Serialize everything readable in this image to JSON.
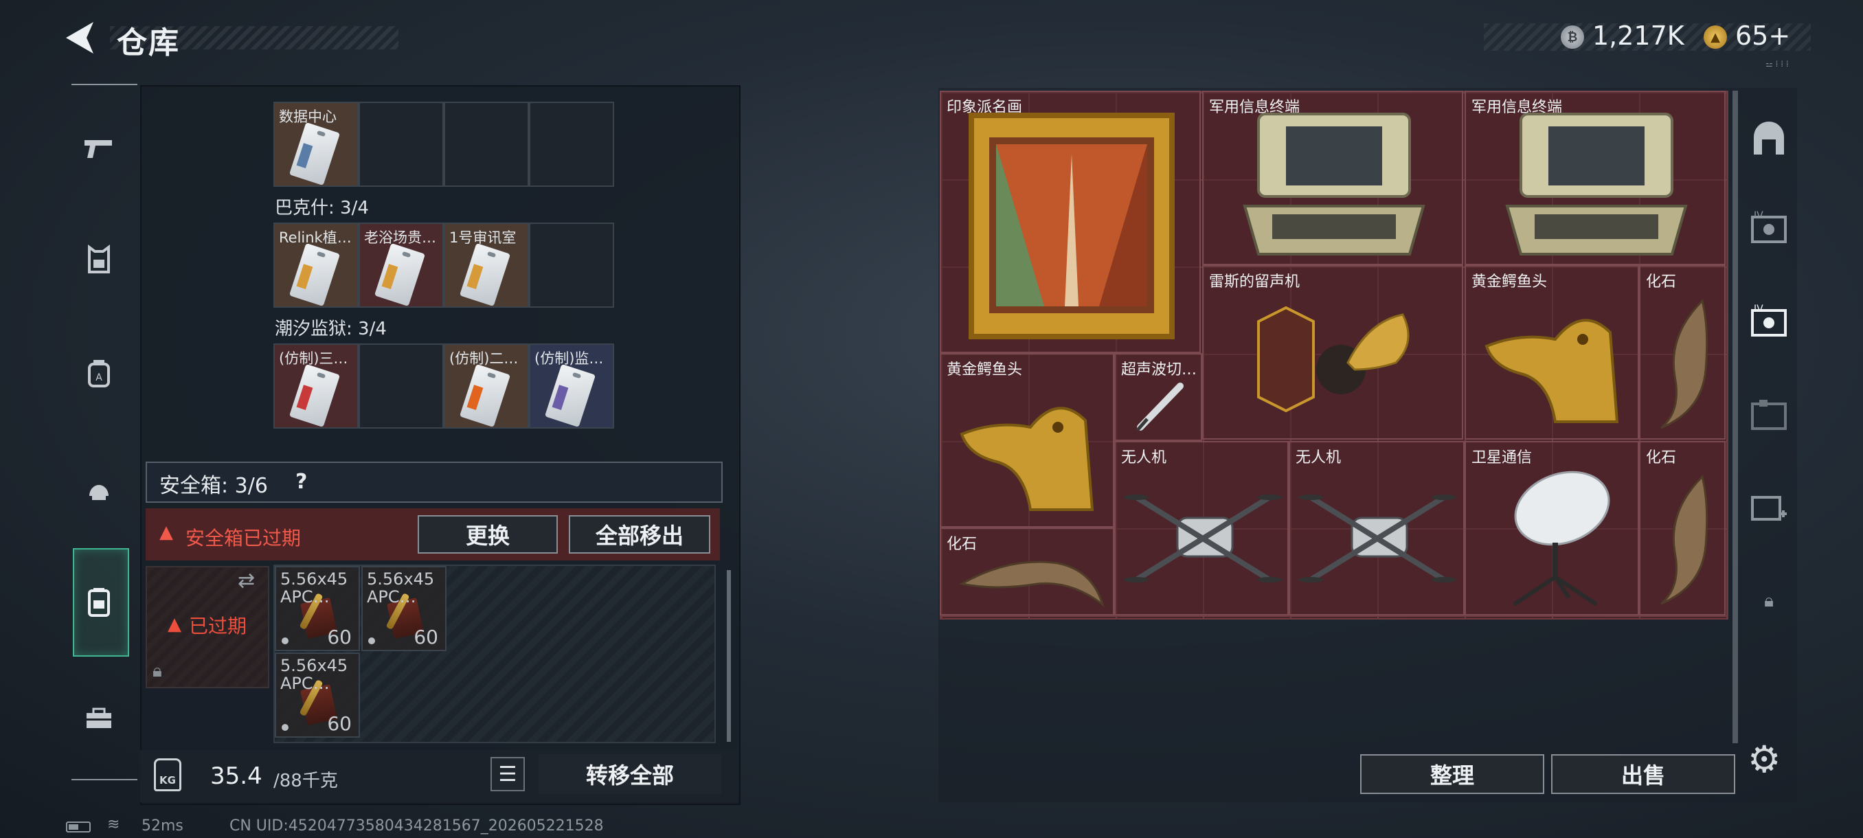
{
  "header": {
    "title": "仓库",
    "currency_silver": "1,217K",
    "currency_gold": "65+",
    "small_text": "⚍ ⁞ ⁞ ⁞"
  },
  "left": {
    "prev_label": "数据中心",
    "sections": [
      {
        "title": "巴克什: 3/4",
        "cells": [
          "Relink植…",
          "老浴场贵…",
          "1号审讯室",
          ""
        ]
      },
      {
        "title": "潮汐监狱: 3/4",
        "cells": [
          "(仿制)三…",
          "",
          "(仿制)二…",
          "(仿制)监…"
        ]
      }
    ],
    "safebox_label": "安全箱: 3/6",
    "safebox_help": "?",
    "expired_warning": "安全箱已过期",
    "btn_replace": "更换",
    "btn_move_all": "全部移出",
    "thumb_expired": "已过期",
    "ammo": [
      {
        "name": "5.56x45 APC…",
        "count": "60"
      },
      {
        "name": "5.56x45 APC…",
        "count": "60"
      },
      {
        "name": "5.56x45 APC…",
        "count": "60"
      }
    ],
    "weight_current": "35.4",
    "weight_max": "/88千克",
    "kg_label": "KG",
    "btn_transfer_all": "转移全部"
  },
  "right": {
    "items": [
      {
        "label": "印象派名画",
        "icon": "painting-icon"
      },
      {
        "label": "军用信息终端",
        "icon": "terminal-icon"
      },
      {
        "label": "军用信息终端",
        "icon": "terminal-icon"
      },
      {
        "label": "雷斯的留声机",
        "icon": "gramophone-icon"
      },
      {
        "label": "黄金鳄鱼头",
        "icon": "golden-croc-icon"
      },
      {
        "label": "化石",
        "icon": "fossil-icon"
      },
      {
        "label": "黄金鳄鱼头",
        "icon": "golden-croc-icon"
      },
      {
        "label": "超声波切…",
        "icon": "ultrasonic-cutter-icon"
      },
      {
        "label": "无人机",
        "icon": "drone-icon"
      },
      {
        "label": "无人机",
        "icon": "drone-icon"
      },
      {
        "label": "卫星通信",
        "icon": "satellite-dish-icon"
      },
      {
        "label": "化石",
        "icon": "fossil-icon"
      },
      {
        "label": "化石",
        "icon": "fossil-icon"
      }
    ],
    "btn_sort": "整理",
    "btn_sell": "出售"
  },
  "status": {
    "ping": "52ms",
    "uid": "CN UID:4520477358043428156​7_202605221528"
  },
  "colors": {
    "accent_green": "#3fb592",
    "warning_red": "#f05a4a",
    "item_bg": "#4b2529"
  }
}
